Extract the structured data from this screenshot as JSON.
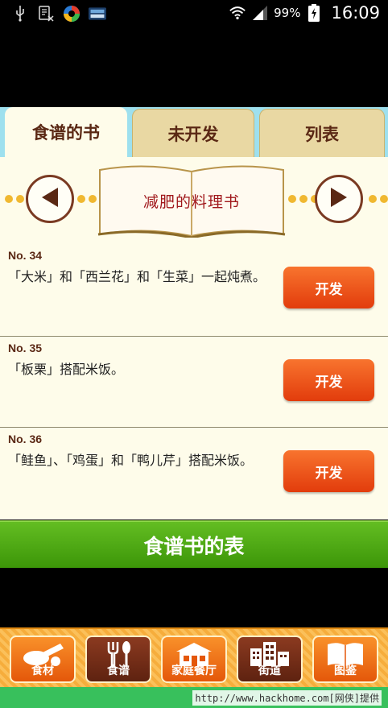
{
  "status_bar": {
    "battery_percent": "99%",
    "time": "16:09",
    "icons": [
      "usb-icon",
      "sim-missing-icon",
      "app-icon",
      "game-icon",
      "wifi-icon",
      "signal-icon",
      "battery-charging-icon"
    ]
  },
  "tabs": [
    {
      "label": "食谱的书",
      "active": true
    },
    {
      "label": "未开发",
      "active": false
    },
    {
      "label": "列表",
      "active": false
    }
  ],
  "book": {
    "title": "减肥的料理书"
  },
  "recipes": [
    {
      "number": "No. 34",
      "description": "「大米」和「西兰花」和「生菜」一起炖煮。",
      "button": "开发"
    },
    {
      "number": "No. 35",
      "description": "「板栗」搭配米饭。",
      "button": "开发"
    },
    {
      "number": "No. 36",
      "description": "「鲑鱼」、「鸡蛋」和「鸭儿芹」搭配米饭。",
      "button": "开发"
    }
  ],
  "banner": {
    "label": "食谱书的表"
  },
  "bottom_nav": [
    {
      "label": "食材",
      "icon": "ingredients-icon",
      "active": false
    },
    {
      "label": "食谱",
      "icon": "fork-spoon-icon",
      "active": true
    },
    {
      "label": "家庭餐厅",
      "icon": "restaurant-icon",
      "active": false
    },
    {
      "label": "街道",
      "icon": "buildings-icon",
      "active": false
    },
    {
      "label": "图鉴",
      "icon": "book-icon",
      "active": false
    }
  ],
  "watermark": "http://www.hackhome.com[网侠]提供",
  "colors": {
    "panel_bg": "#fefcea",
    "tab_inactive": "#e9d8a3",
    "develop_button": "#f06020",
    "banner_green": "#4fa814",
    "title_red": "#a0181c",
    "text_brown": "#5a2814"
  }
}
